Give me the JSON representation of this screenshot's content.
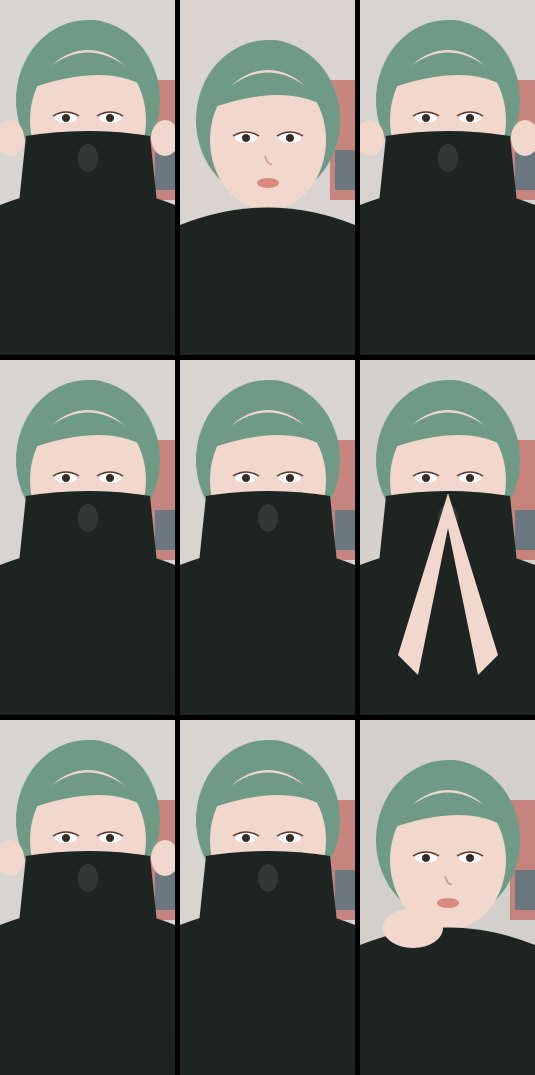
{
  "grid": {
    "rows": 3,
    "cols": 3,
    "gap_color": "#000000",
    "cells": [
      {
        "pose": "shirt-pulled-over-nose",
        "hands": "both-at-shirt-collar",
        "bg": "#d8d6d3"
      },
      {
        "pose": "face-visible-smiling",
        "hands": "none",
        "bg": "#d9d4cf"
      },
      {
        "pose": "shirt-pulled-over-nose",
        "hands": "both-at-shirt-collar",
        "bg": "#d6d3d0"
      },
      {
        "pose": "shirt-pulled-over-nose",
        "hands": "none",
        "bg": "#d7d4d1"
      },
      {
        "pose": "shirt-pulled-to-mouth",
        "hands": "none",
        "bg": "#d8d4d0"
      },
      {
        "pose": "hands-over-nose",
        "hands": "fingers-together-at-nose",
        "bg": "#d5d1cd"
      },
      {
        "pose": "shirt-pulled-over-nose",
        "hands": "both-at-shirt-collar",
        "bg": "#d7d5d2"
      },
      {
        "pose": "shirt-pulled-over-nose",
        "hands": "none",
        "bg": "#d8d5d1"
      },
      {
        "pose": "face-visible-hand-at-chin",
        "hands": "one-at-chin",
        "bg": "#d3d0cc"
      }
    ]
  },
  "colors": {
    "skin": "#f1d7cc",
    "hair": "#6f9a86",
    "shirt": "#1d2422",
    "lips": "#d9897f"
  }
}
